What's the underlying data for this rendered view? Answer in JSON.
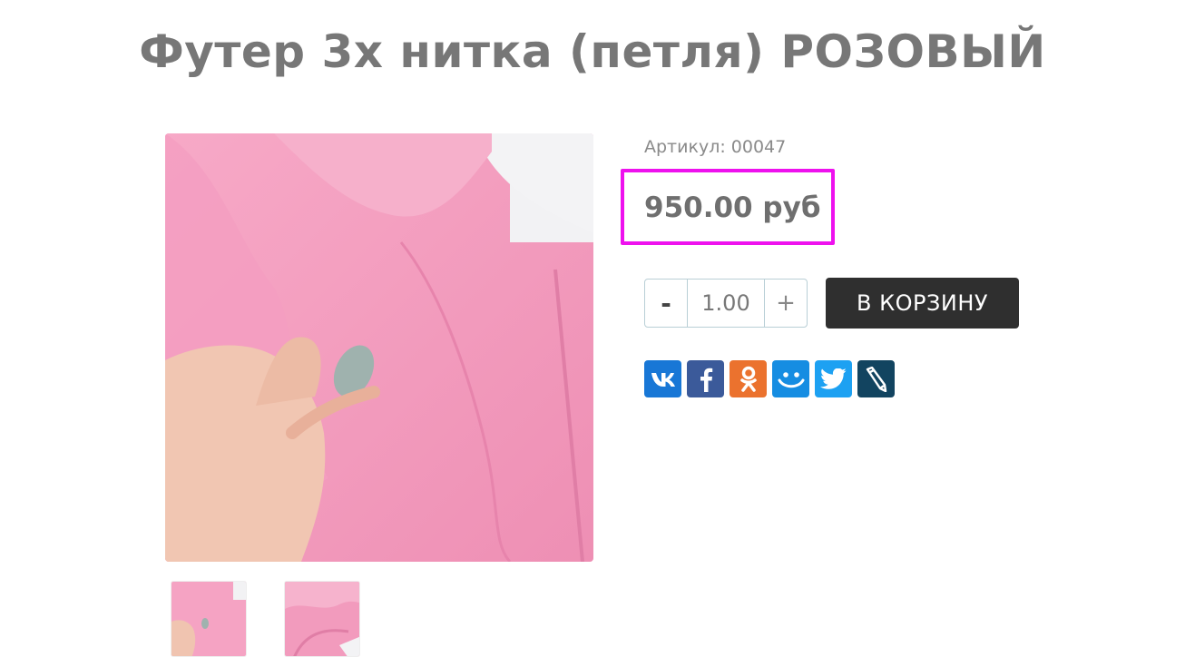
{
  "product": {
    "title": "Футер 3х нитка (петля) РОЗОВЫЙ",
    "sku_label": "Артикул: 00047",
    "price": "950.00 руб"
  },
  "quantity": {
    "minus_label": "-",
    "value": "1.00",
    "plus_label": "+"
  },
  "cart": {
    "button_label": "В КОРЗИНУ"
  },
  "share": {
    "items": [
      {
        "name": "vk-icon",
        "color": "#1877d6"
      },
      {
        "name": "facebook-icon",
        "color": "#3b5a9a"
      },
      {
        "name": "odnoklassniki-icon",
        "color": "#eb722e"
      },
      {
        "name": "moimir-icon",
        "color": "#168de2"
      },
      {
        "name": "twitter-icon",
        "color": "#1da1f2"
      },
      {
        "name": "livejournal-icon",
        "color": "#124460"
      }
    ]
  },
  "colors": {
    "highlight_border": "#ee11ee",
    "button_bg": "#2f2f2f",
    "fabric_pink": "#f4a6c4"
  }
}
